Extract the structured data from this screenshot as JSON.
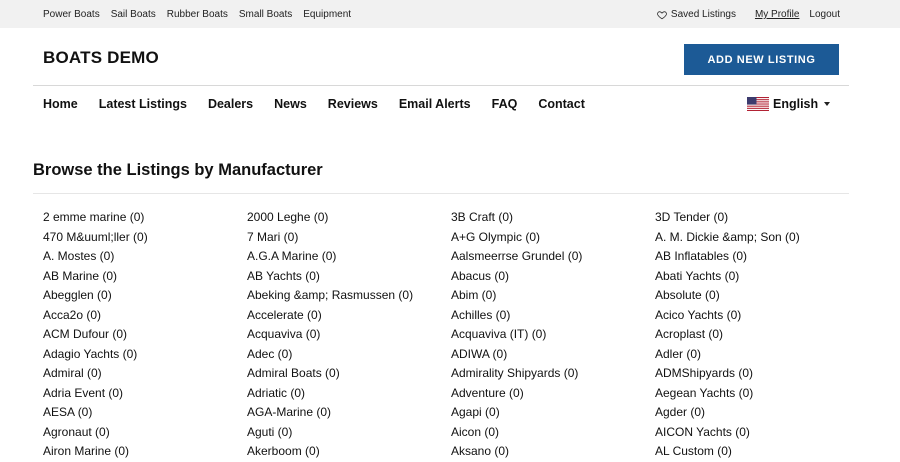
{
  "topbar": {
    "categories": [
      "Power Boats",
      "Sail Boats",
      "Rubber Boats",
      "Small Boats",
      "Equipment"
    ],
    "saved_listings": "Saved Listings",
    "my_profile": "My Profile",
    "logout": "Logout"
  },
  "header": {
    "logo": "BOATS DEMO",
    "add_listing": "ADD NEW LISTING"
  },
  "nav": {
    "items": [
      "Home",
      "Latest Listings",
      "Dealers",
      "News",
      "Reviews",
      "Email Alerts",
      "FAQ",
      "Contact"
    ],
    "language": "English"
  },
  "main": {
    "heading": "Browse the Listings by Manufacturer",
    "manufacturers": [
      "2 emme marine (0)",
      "2000 Leghe (0)",
      "3B Craft (0)",
      "3D Tender (0)",
      "470 M&uuml;ller (0)",
      "7 Mari (0)",
      "A+G Olympic (0)",
      "A. M. Dickie &amp; Son (0)",
      "A. Mostes (0)",
      "A.G.A Marine (0)",
      "Aalsmeerrse Grundel (0)",
      "AB Inflatables (0)",
      "AB Marine (0)",
      "AB Yachts (0)",
      "Abacus (0)",
      "Abati Yachts (0)",
      "Abegglen (0)",
      "Abeking &amp; Rasmussen (0)",
      "Abim (0)",
      "Absolute (0)",
      "Acca2o (0)",
      "Accelerate (0)",
      "Achilles (0)",
      "Acico Yachts (0)",
      "ACM Dufour (0)",
      "Acquaviva (0)",
      "Acquaviva (IT) (0)",
      "Acroplast (0)",
      "Adagio Yachts (0)",
      "Adec (0)",
      "ADIWA (0)",
      "Adler (0)",
      "Admiral (0)",
      "Admiral Boats (0)",
      "Admirality Shipyards (0)",
      "ADMShipyards (0)",
      "Adria Event (0)",
      "Adriatic (0)",
      "Adventure (0)",
      "Aegean Yachts (0)",
      "AESA (0)",
      "AGA-Marine (0)",
      "Agapi (0)",
      "Agder (0)",
      "Agronaut (0)",
      "Aguti (0)",
      "Aicon (0)",
      "AICON Yachts (0)",
      "Airon Marine (0)",
      "Akerboom (0)",
      "Aksano (0)",
      "AL Custom (0)"
    ]
  }
}
